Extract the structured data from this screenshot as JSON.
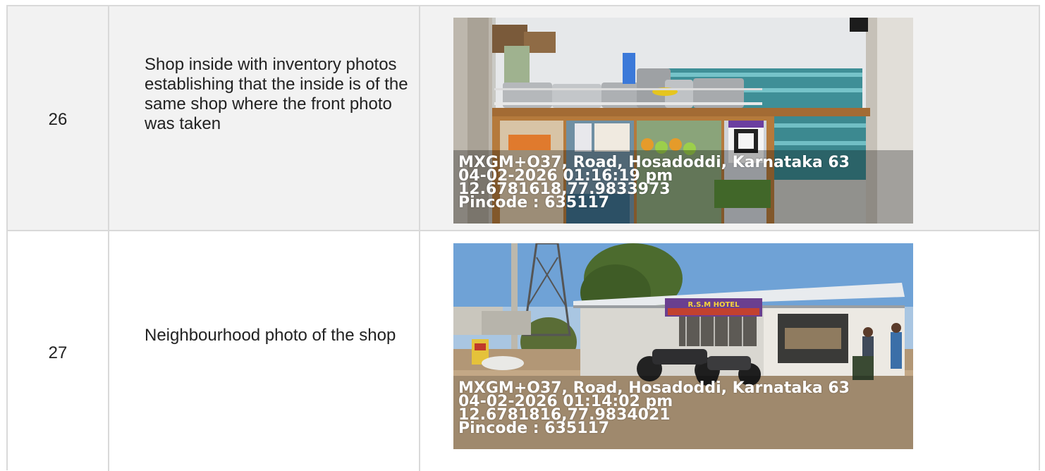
{
  "rows": [
    {
      "number": "26",
      "description": "Shop inside with inventory photos establishing that the inside is of the same shop where the front photo was taken",
      "photo": {
        "subject": "shop-interior",
        "overlay": {
          "address": "MXGM+O37, Road, Hosadoddi, Karnataka 63",
          "datetime": "04-02-2026 01:16:19 pm",
          "coordinates": "12.6781618,77.9833973",
          "pincode": "Pincode : 635117"
        }
      }
    },
    {
      "number": "27",
      "description": "Neighbourhood photo of the shop",
      "photo": {
        "subject": "shop-exterior",
        "sign_text": "R.S.M HOTEL",
        "overlay": {
          "address": "MXGM+O37, Road, Hosadoddi, Karnataka 63",
          "datetime": "04-02-2026 01:14:02 pm",
          "coordinates": "12.6781816,77.9834021",
          "pincode": "Pincode : 635117"
        }
      }
    }
  ],
  "colors": {
    "row_shaded": "#f2f2f2",
    "border": "#d9d9d9",
    "text": "#222222"
  }
}
